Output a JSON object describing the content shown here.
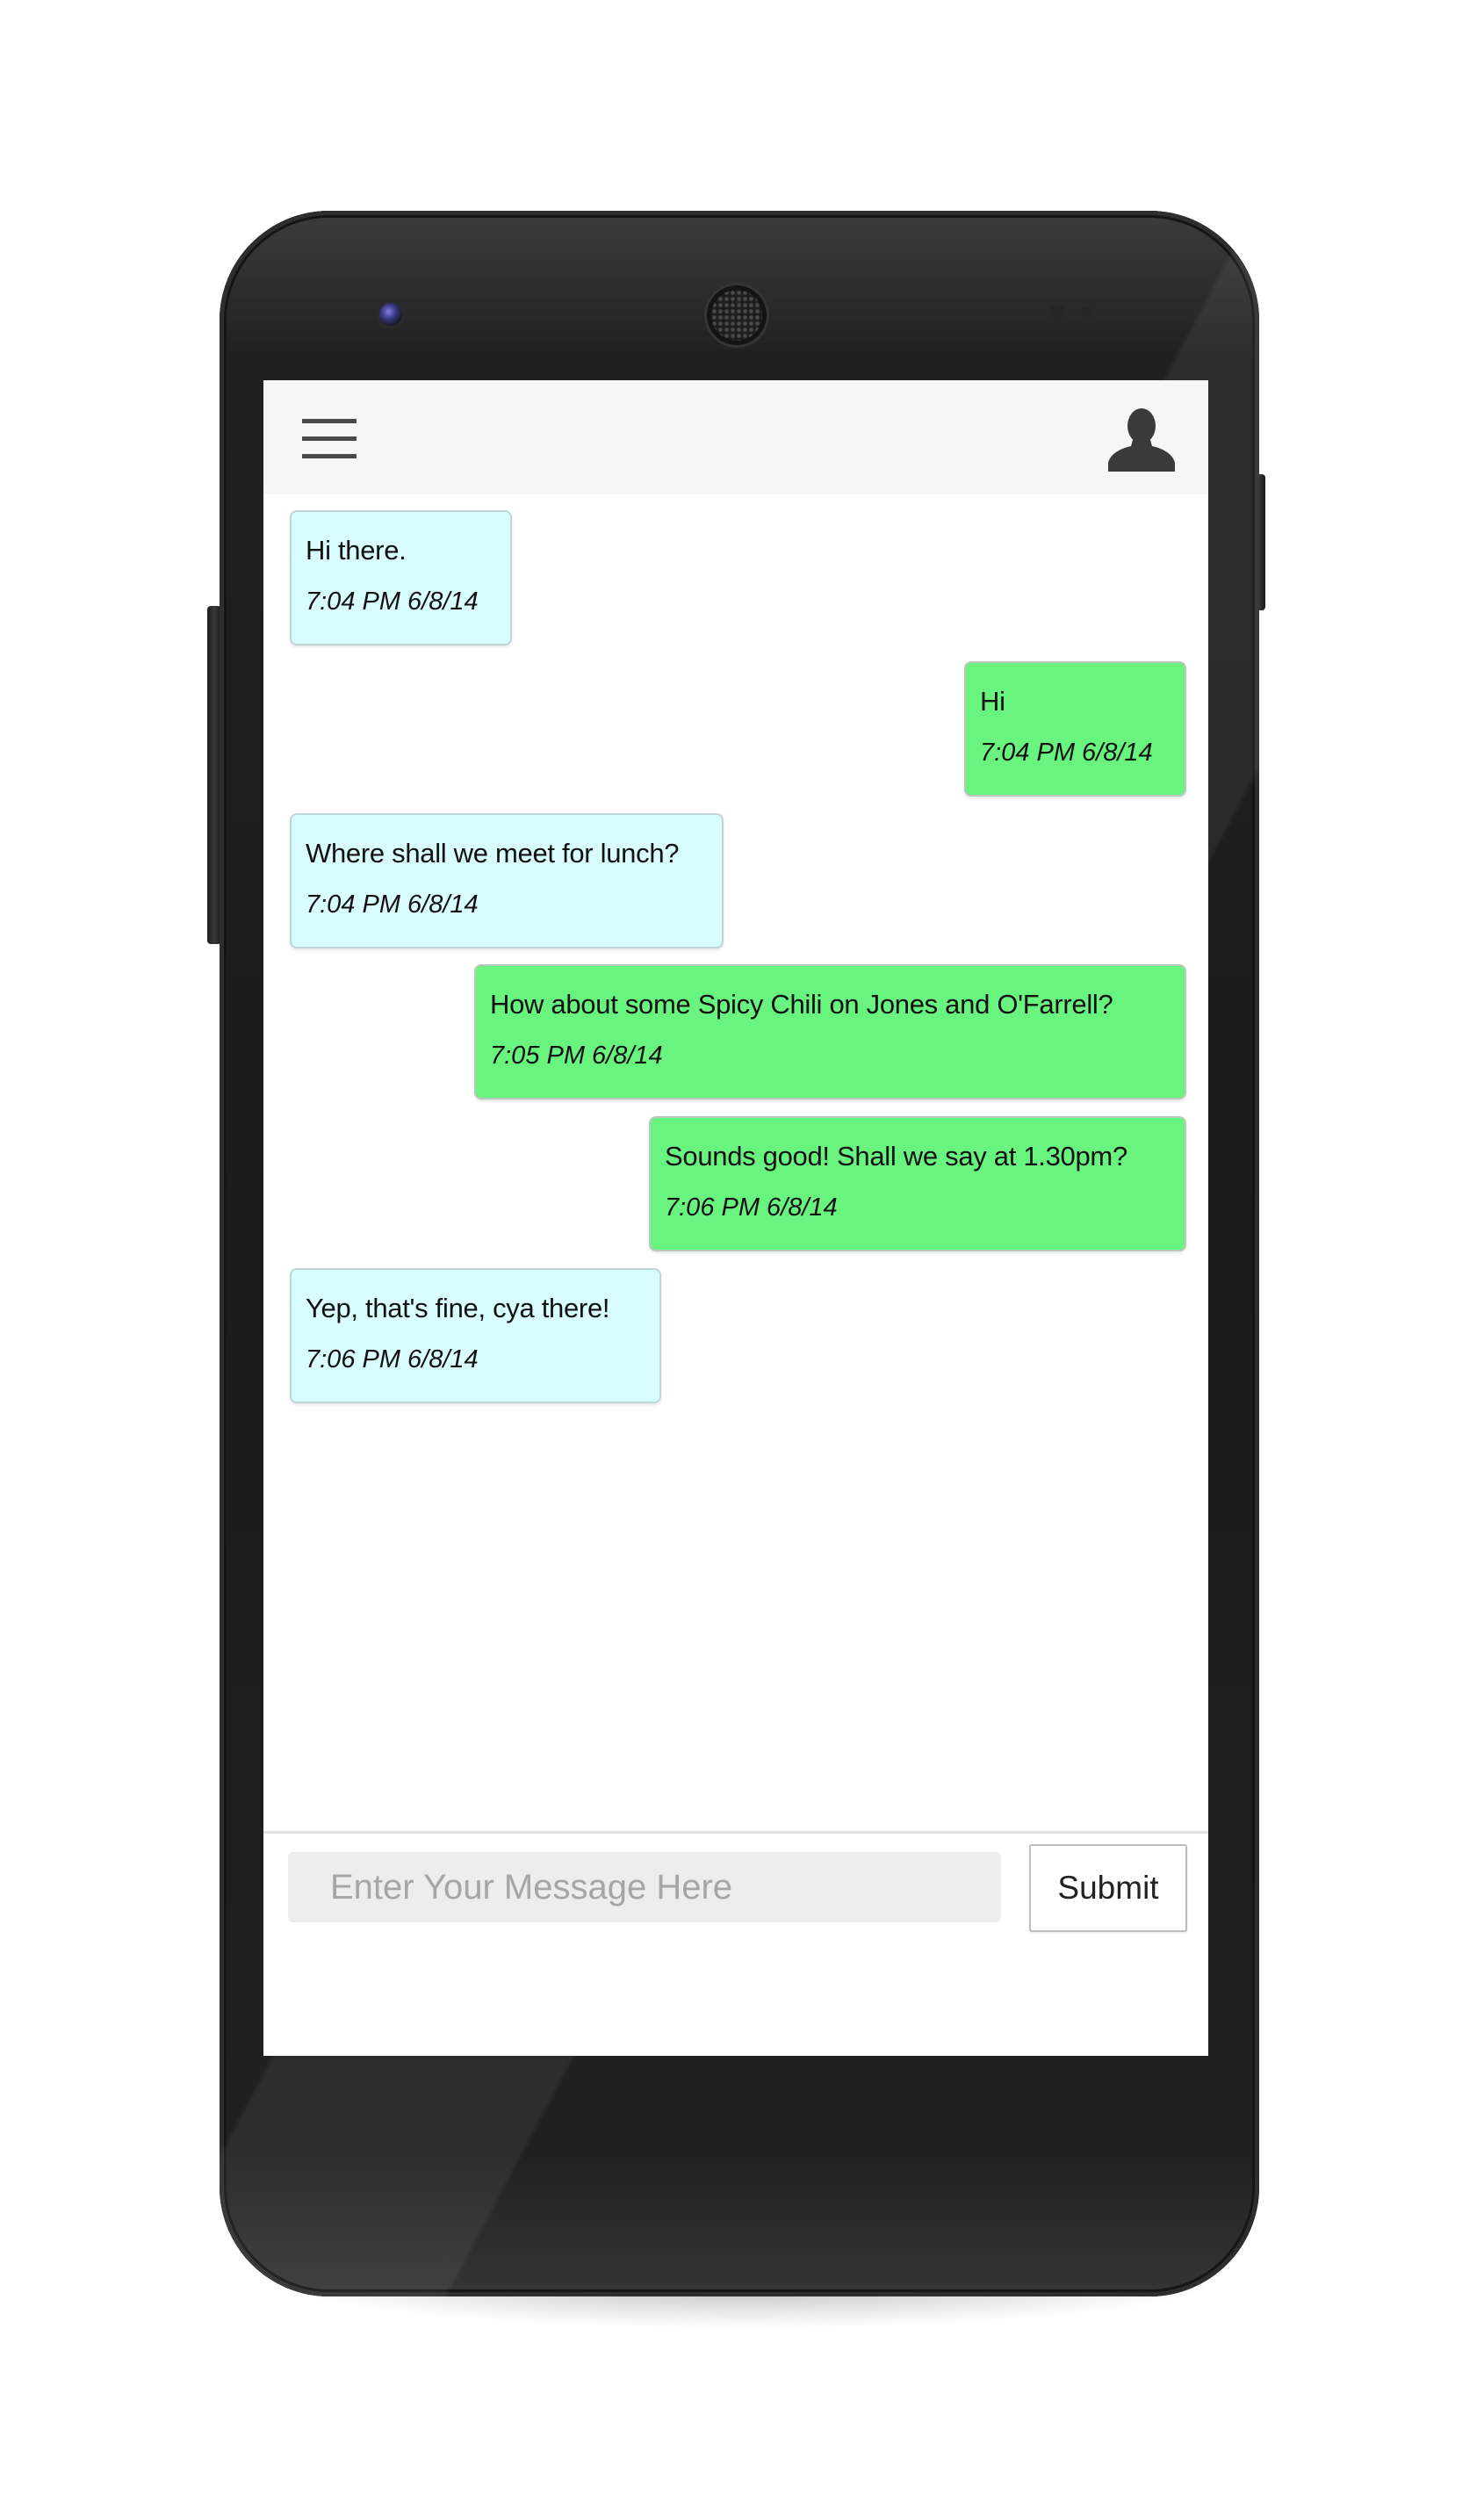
{
  "header": {
    "menu_icon": "hamburger-menu-icon",
    "profile_icon": "user-silhouette-icon"
  },
  "messages": [
    {
      "direction": "incoming",
      "text": "Hi there.",
      "time": "7:04 PM 6/8/14"
    },
    {
      "direction": "outgoing",
      "text": "Hi",
      "time": "7:04 PM 6/8/14"
    },
    {
      "direction": "incoming",
      "text": "Where shall we meet for lunch?",
      "time": "7:04 PM 6/8/14"
    },
    {
      "direction": "outgoing",
      "text": "How about some Spicy Chili on Jones and O'Farrell?",
      "time": "7:05 PM 6/8/14"
    },
    {
      "direction": "outgoing",
      "text": "Sounds good! Shall we say at 1.30pm?",
      "time": "7:06 PM 6/8/14"
    },
    {
      "direction": "incoming",
      "text": "Yep, that's fine, cya there!",
      "time": "7:06 PM 6/8/14"
    }
  ],
  "composer": {
    "placeholder": "Enter Your Message Here",
    "value": "",
    "submit_label": "Submit"
  },
  "colors": {
    "incoming_bubble": "#d9fcfe",
    "outgoing_bubble": "#69f37f",
    "header_background": "#f6f6f6",
    "input_background": "#ededed",
    "phone_body": "#1b1b1b"
  }
}
